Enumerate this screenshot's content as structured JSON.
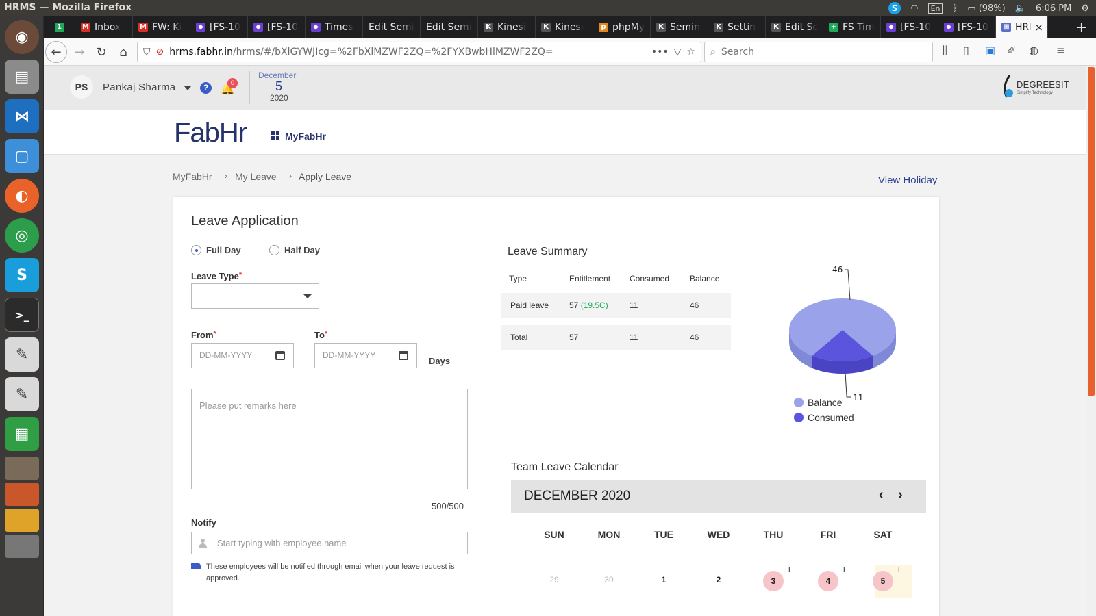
{
  "os": {
    "window_title": "HRMS — Mozilla Firefox",
    "battery": "(98%)",
    "time": "6:06 PM",
    "keyboard": "En"
  },
  "browser": {
    "tabs": [
      {
        "label": "",
        "color": "#1eaa5a",
        "glyph": "1"
      },
      {
        "label": "Inbox",
        "color": "#d93025",
        "glyph": "M"
      },
      {
        "label": "FW: Ki",
        "color": "#d93025",
        "glyph": "M"
      },
      {
        "label": "[FS-10",
        "color": "#6b3fd4",
        "glyph": "◆"
      },
      {
        "label": "[FS-10",
        "color": "#6b3fd4",
        "glyph": "◆"
      },
      {
        "label": "Times",
        "color": "#6b3fd4",
        "glyph": "◆"
      },
      {
        "label": "Edit Semi",
        "color": "",
        "glyph": ""
      },
      {
        "label": "Edit Semi",
        "color": "",
        "glyph": ""
      },
      {
        "label": "Kinesi",
        "color": "#555",
        "glyph": "K"
      },
      {
        "label": "Kinesi",
        "color": "#555",
        "glyph": "K"
      },
      {
        "label": "phpMy",
        "color": "#e08a1e",
        "glyph": "p"
      },
      {
        "label": "Semin",
        "color": "#555",
        "glyph": "K"
      },
      {
        "label": "Settin",
        "color": "#555",
        "glyph": "K"
      },
      {
        "label": "Edit Sc",
        "color": "#555",
        "glyph": "K"
      },
      {
        "label": "FS Tim",
        "color": "#1eaa5a",
        "glyph": "+"
      },
      {
        "label": "[FS-10",
        "color": "#6b3fd4",
        "glyph": "◆"
      },
      {
        "label": "[FS-10",
        "color": "#6b3fd4",
        "glyph": "◆"
      },
      {
        "label": "HRI",
        "color": "#5b6fc8",
        "glyph": "▦"
      }
    ],
    "url_host": "hrms.fabhr.in",
    "url_rest": "/hrms/#/bXlGYWJIcg=%2FbXlMZWF2ZQ=%2FYXBwbHlMZWF2ZQ=",
    "search_placeholder": "Search",
    "url_dots": "•••"
  },
  "header": {
    "initials": "PS",
    "user_name": "Pankaj Sharma",
    "notif_count": "0",
    "date_month": "December",
    "date_day": "5",
    "date_year": "2020",
    "company": "DEGREESIT",
    "company_tagline": "Simplify Technology"
  },
  "brand": {
    "logo": "FabHr",
    "menu_label": "MyFabHr"
  },
  "breadcrumb": {
    "items": [
      "MyFabHr",
      "My Leave",
      "Apply Leave"
    ],
    "view_holiday": "View Holiday"
  },
  "form": {
    "title": "Leave Application",
    "full_day": "Full Day",
    "half_day": "Half Day",
    "leave_type_label": "Leave Type",
    "required_mark": "*",
    "from_label": "From",
    "to_label": "To",
    "from_placeholder": "DD-MM-YYYY",
    "to_placeholder": "DD-MM-YYYY",
    "days_label": "Days",
    "remarks_placeholder": "Please put remarks here",
    "char_count": "500/500",
    "notify_label": "Notify",
    "notify_placeholder": "Start typing with employee name",
    "notify_hint": "These employees will be notified through email when your leave request is approved."
  },
  "summary": {
    "title": "Leave Summary",
    "headers": [
      "Type",
      "Entitlement",
      "Consumed",
      "Balance"
    ],
    "rows": [
      {
        "type": "Paid leave",
        "entitlement": "57",
        "extra": "(19.5C)",
        "consumed": "11",
        "balance": "46"
      },
      {
        "type": "Total",
        "entitlement": "57",
        "extra": "",
        "consumed": "11",
        "balance": "46"
      }
    ],
    "pie_balance_label": "46",
    "pie_consumed_label": "11",
    "legend": [
      {
        "label": "Balance",
        "color": "#9aa3ea"
      },
      {
        "label": "Consumed",
        "color": "#5a55dc"
      }
    ]
  },
  "chart_data": {
    "type": "pie",
    "categories": [
      "Balance",
      "Consumed"
    ],
    "values": [
      46,
      11
    ],
    "labels": [
      "46",
      "11"
    ],
    "legend_position": "bottom"
  },
  "calendar": {
    "title": "Team Leave Calendar",
    "month": "DECEMBER 2020",
    "prev": "‹",
    "next": "›",
    "weekdays": [
      "SUN",
      "MON",
      "TUE",
      "WED",
      "THU",
      "FRI",
      "SAT"
    ],
    "days": [
      {
        "n": "29",
        "muted": true,
        "leave": false
      },
      {
        "n": "30",
        "muted": true,
        "leave": false
      },
      {
        "n": "1",
        "muted": false,
        "leave": false
      },
      {
        "n": "2",
        "muted": false,
        "leave": false
      },
      {
        "n": "3",
        "muted": false,
        "leave": true
      },
      {
        "n": "4",
        "muted": false,
        "leave": true
      },
      {
        "n": "5",
        "muted": false,
        "leave": true,
        "today": true
      }
    ],
    "leave_mark": "L"
  }
}
